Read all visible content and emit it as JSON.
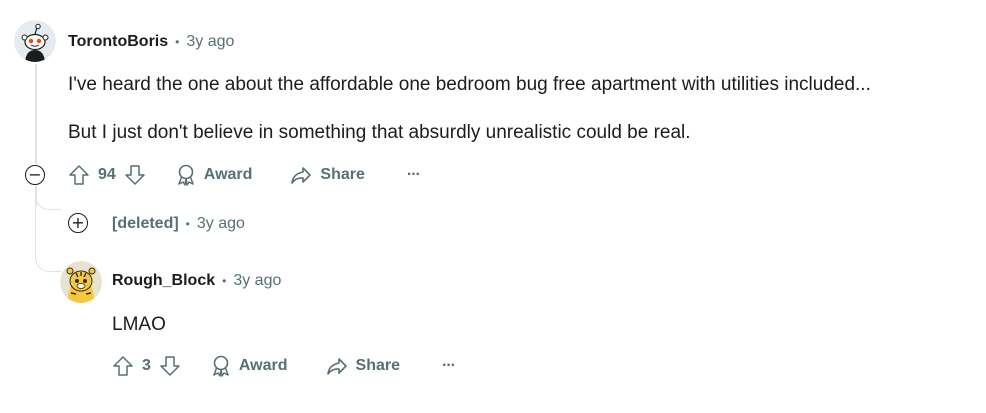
{
  "comments": [
    {
      "author": "TorontoBoris",
      "time": "3y ago",
      "body": [
        "I've heard the one about the affordable one bedroom bug free apartment with utilities included...",
        "But I just don't believe in something that absurdly unrealistic could be real."
      ],
      "score": "94",
      "award_label": "Award",
      "share_label": "Share",
      "more_label": "···",
      "collapse_symbol": "−"
    },
    {
      "author": "[deleted]",
      "time": "3y ago",
      "expand_symbol": "+"
    },
    {
      "author": "Rough_Block",
      "time": "3y ago",
      "body": [
        "LMAO"
      ],
      "score": "3",
      "award_label": "Award",
      "share_label": "Share",
      "more_label": "···"
    }
  ],
  "separator": "•",
  "colors": {
    "meta_gray": "#576f76",
    "thread_line": "#dfe3e6",
    "text": "#1c1c1c"
  },
  "icons": [
    "snoo-avatar-icon",
    "tiger-avatar-icon",
    "upvote-icon",
    "downvote-icon",
    "award-icon",
    "share-icon",
    "more-icon",
    "collapse-icon",
    "expand-icon"
  ]
}
